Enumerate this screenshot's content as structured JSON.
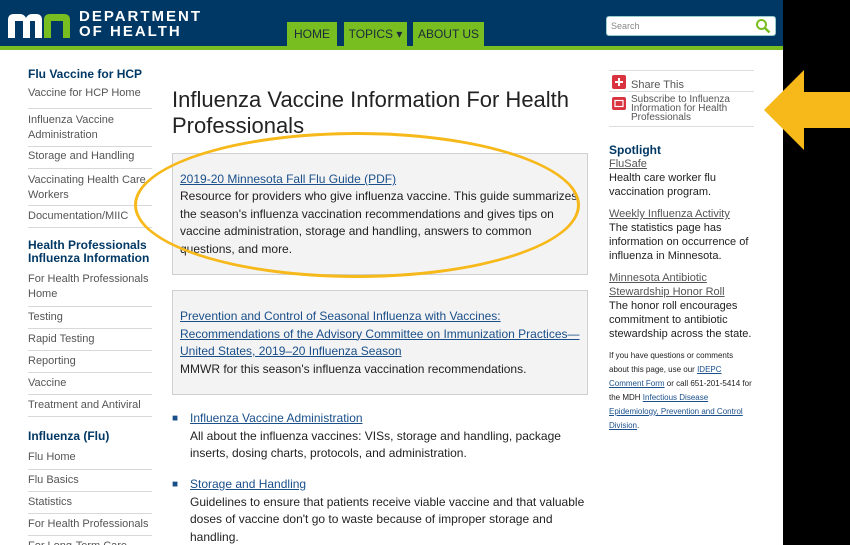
{
  "header": {
    "dept_line1": "DEPARTMENT",
    "dept_line2": "OF HEALTH",
    "nav": [
      {
        "label": "HOME"
      },
      {
        "label": "TOPICS ▾"
      },
      {
        "label": "ABOUT US"
      }
    ],
    "search_placeholder": "Search"
  },
  "left_sidebar": {
    "sections": [
      {
        "heading": "Flu Vaccine for HCP",
        "items": [
          "Vaccine for HCP Home",
          "Influenza Vaccine Administration",
          "Storage and Handling",
          "Vaccinating Health Care Workers",
          "Documentation/MIIC"
        ]
      },
      {
        "heading": "Health Professionals Influenza Information",
        "items": [
          "For Health Professionals Home",
          "Testing",
          "Rapid Testing",
          "Reporting",
          "Vaccine",
          "Treatment and Antiviral"
        ]
      },
      {
        "heading": "Influenza (Flu)",
        "items": [
          "Flu Home",
          "Flu Basics",
          "Statistics",
          "For Health Professionals",
          "For Long-Term Care"
        ]
      }
    ]
  },
  "main": {
    "title": "Influenza Vaccine Information For Health Professionals",
    "box1": {
      "link": "2019-20 Minnesota Fall Flu Guide (PDF)",
      "text": "Resource for providers who give influenza vaccine. This guide summarizes the season's influenza vaccination recommendations and gives tips on vaccine administration, storage and handling, answers to common questions, and more."
    },
    "box2": {
      "link": "Prevention and Control of Seasonal Influenza with Vaccines: Recommendations of the Advisory Committee on Immunization Practices—United States, 2019–20 Influenza Season",
      "text": "MMWR for this season's influenza vaccination recommendations."
    },
    "bullets": [
      {
        "link": "Influenza Vaccine Administration",
        "text": "All about the influenza vaccines: VISs, storage and handling, package inserts, dosing charts, protocols, and administration."
      },
      {
        "link": "Storage and Handling",
        "text": "Guidelines to ensure that patients receive viable vaccine and that valuable doses of vaccine don't go to waste because of improper storage and handling."
      }
    ]
  },
  "right_sidebar": {
    "share": "Share This",
    "subscribe": "Subscribe to Influenza Information for Health Professionals",
    "spotlight_heading": "Spotlight",
    "spotlight": [
      {
        "link": "FluSafe",
        "text": "Health care worker flu vaccination program."
      },
      {
        "link": "Weekly Influenza Activity",
        "text": "The statistics page has information on occurrence of influenza in Minnesota."
      },
      {
        "link": "Minnesota Antibiotic Stewardship Honor Roll",
        "text": "The honor roll encourages commitment to antibiotic stewardship across the state."
      }
    ],
    "contact": {
      "pre": "If you have questions or comments about this page, use our ",
      "link1": "IDEPC Comment Form",
      "mid": " or call 651-201-5414 for the MDH ",
      "link2": "Infectious Disease Epidemiology, Prevention and Control Division",
      "post": "."
    }
  },
  "colors": {
    "header_bg": "#003865",
    "accent_green": "#78be21",
    "highlight": "#f7b81a"
  }
}
